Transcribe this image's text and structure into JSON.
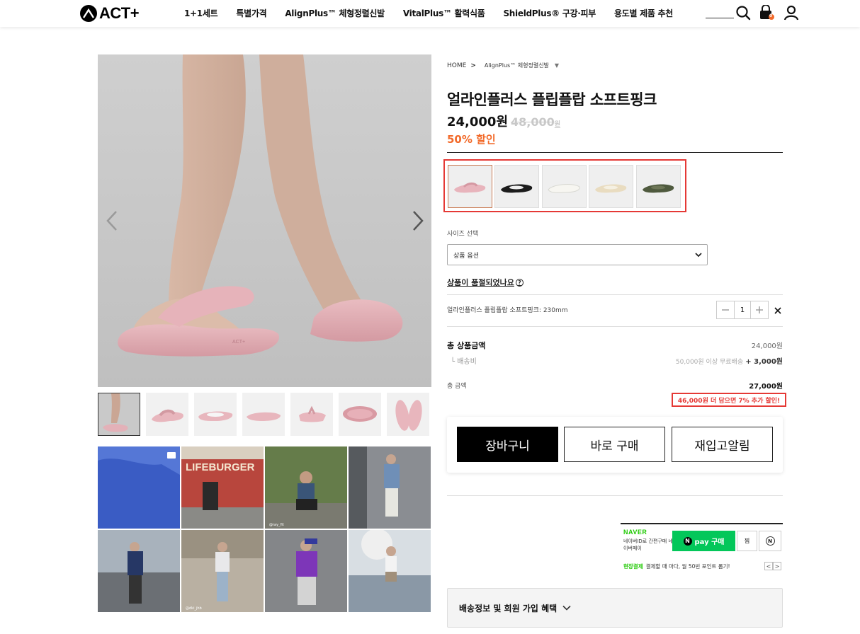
{
  "header": {
    "logo": "ACT+",
    "nav": [
      "1+1세트",
      "특별가격",
      "AlignPlus™ 체형정렬신발",
      "VitalPlus™ 활력식품",
      "ShieldPlus® 구강·피부",
      "용도별 제품 추천"
    ],
    "cart_count": "0"
  },
  "breadcrumb": {
    "home": "HOME",
    "sep": ">",
    "category": "AlignPlus™ 체형정렬신발",
    "caret": "▼"
  },
  "product": {
    "title": "얼라인플러스 플립플랍 소프트핑크",
    "price": "24,000원",
    "original_price": "48,000",
    "original_unit": "원",
    "discount": "50% 할인"
  },
  "colors": {
    "swatches": [
      {
        "name": "pink",
        "color": "#e8b4bc",
        "selected": true
      },
      {
        "name": "black",
        "color": "#1c1c1c",
        "selected": false
      },
      {
        "name": "white",
        "color": "#f2f1ec",
        "selected": false
      },
      {
        "name": "beige",
        "color": "#e9dcc0",
        "selected": false
      },
      {
        "name": "olive",
        "color": "#4f5a3e",
        "selected": false
      }
    ],
    "highlight": "#e53935"
  },
  "size": {
    "label": "사이즈 선택",
    "placeholder": "상품 옵션"
  },
  "soldout_link": "상품이 품절되었나요",
  "soldout_help": "?",
  "selected_option": {
    "name": "얼라인플러스 플립플랍 소프트핑크: 230mm",
    "quantity": "1"
  },
  "summary": {
    "subtotal_label": "총 상품금액",
    "subtotal_value": "24,000원",
    "shipping_label": "└ 배송비",
    "shipping_note": "50,000원 이상 무료배송",
    "shipping_value": "+ 3,000원",
    "total_label": "총 금액",
    "total_value": "27,000원",
    "promo": "46,000원 더 담으면 7% 추가 할인!"
  },
  "buttons": {
    "cart": "장바구니",
    "buy": "바로 구매",
    "restock": "재입고알림"
  },
  "naver": {
    "logo": "NAVER",
    "desc": "네이버ID로 간편구매 네이버페이",
    "pay_label": "pay 구매",
    "pay_n": "N",
    "zzim": "찜",
    "talk": "N",
    "promo_tag": "현장결제",
    "promo_text": "결제할 때 마다, 월 50빈 포인트 롭기!",
    "prev": "<",
    "next": ">"
  },
  "shipping_info": {
    "label": "배송정보 및 회원 가입 혜택"
  },
  "gallery": {
    "overlay": "LIFEBURGER",
    "tags": [
      "@ray_fit",
      "@dki_jhb"
    ]
  }
}
